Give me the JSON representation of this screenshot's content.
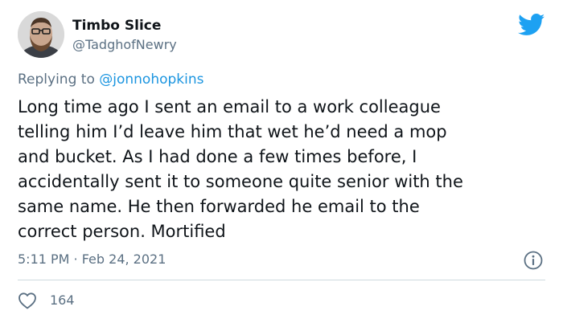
{
  "user": {
    "display_name": "Timbo Slice",
    "handle": "@TadghofNewry"
  },
  "reply": {
    "prefix": "Replying to",
    "mention": "@jonnohopkins"
  },
  "tweet": {
    "lines": [
      "Long time ago I sent an email to a work colleague",
      "telling him I’d leave him that wet he’d need a mop",
      "and bucket. As I had done a few times before, I",
      "accidentally sent it to someone quite senior with the",
      "same name. He then forwarded he email to the",
      "correct person. Mortified"
    ],
    "timestamp": "5:11 PM · Feb 24, 2021"
  },
  "engagement": {
    "like_count": "164"
  },
  "icons": {
    "brand": "twitter-bird-icon",
    "info": "info-icon",
    "like": "heart-icon"
  },
  "colors": {
    "brand_blue": "#1DA1F2",
    "mention_blue": "#1b95e0",
    "secondary_text": "#5b7083",
    "primary_text": "#0f1419",
    "divider": "#cfd9de"
  }
}
